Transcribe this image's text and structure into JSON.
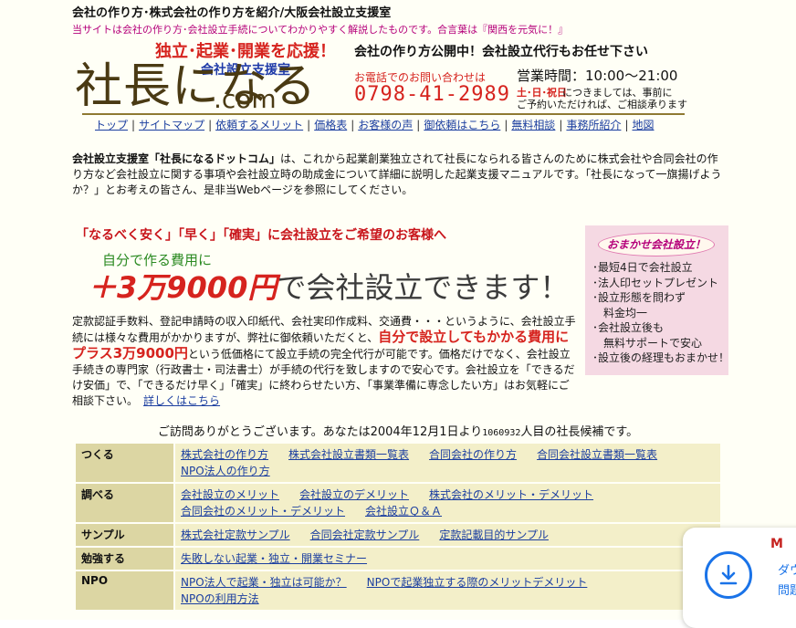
{
  "header": {
    "title": "会社の作り方･株式会社の作り方を紹介/大阪会社設立支援室",
    "subtitle": "当サイトは会社の作り方･会社設立手続についてわかりやすく解説したものです。合言葉は『関西を元気に！』",
    "logo": {
      "slogan": "独立･起業･開業を応援！",
      "sub": "会社設立支援室",
      "main": "社長になる",
      "com": ".com"
    },
    "right": {
      "headline": "会社の作り方公開中！会社設立代行もお任せ下さい",
      "tel_label": "お電話でのお問い合わせは",
      "tel": "0798-41-2989",
      "hours": "営業時間：10:00～21:00",
      "weekend": "土･日･祝日",
      "note1": "につきましては、事前に",
      "note2": "ご予約いただければ、ご相談承ります"
    }
  },
  "nav": [
    "トップ",
    "サイトマップ",
    "依頼するメリット",
    "価格表",
    "お客様の声",
    "御依頼はこちら",
    "無料相談",
    "事務所紹介",
    "地図"
  ],
  "intro": {
    "lead_bold": "会社設立支援室「社長になるドットコム」",
    "text": "は、これから起業創業独立されて社長になられる皆さんのために株式会社や合同会社の作り方など会社設立に関する事項や会社設立時の助成金について詳細に説明した起業支援マニュアルです。「社長になって一旗揚げようか？」とお考えの皆さん、是非当Webページを参照にしてください。"
  },
  "promo": {
    "headline": "「なるべく安く」「早く」「確実」に会社設立をご希望のお客様へ",
    "small": "自分で作る費用に",
    "plus": "＋3万9000円",
    "rest": "で会社設立できます！",
    "body1": "定款認証手数料、登記申請時の収入印紙代、会社実印作成料、交通費・・・というように、会社設立手続には様々な費用がかかりますが、弊社に御依頼いただくと、",
    "body_em": "自分で設立してもかかる費用にプラス3万9000円",
    "body2": "という低価格にて設立手続の完全代行が可能です。価格だけでなく、会社設立手続きの専門家（行政書士・司法書士）が手続の代行を致しますので安心です。会社設立を「できるだけ安価」で、「できるだけ早く」「確実」に終わらせたい方、「事業準備に専念したい方」はお気軽にご相談下さい。",
    "details_link": "詳しくはこちら"
  },
  "omakase": {
    "title": "おまかせ会社設立！",
    "items": [
      "･最短4日で会社設立",
      "･法人印セットプレゼント",
      "･設立形態を問わず",
      "　料金均一",
      "･会社設立後も",
      "　無料サポートで安心",
      "･設立後の経理もおまかせ！"
    ]
  },
  "visit": {
    "before": "ご訪問ありがとうございます。あなたは2004年12月1日より",
    "count": "1060932",
    "after": "人目の社長候補です。"
  },
  "menu": [
    {
      "category": "つくる",
      "links": [
        "株式会社の作り方",
        "株式会社設立書類一覧表",
        "合同会社の作り方",
        "合同会社設立書類一覧表",
        "NPO法人の作り方"
      ]
    },
    {
      "category": "調べる",
      "links": [
        "会社設立のメリット",
        "会社設立のデメリット",
        "株式会社のメリット・デメリット",
        "合同会社のメリット・デメリット",
        "会社設立Ｑ＆Ａ"
      ]
    },
    {
      "category": "サンプル",
      "links": [
        "株式会社定款サンプル",
        "合同会社定款サンプル",
        "定款記載目的サンプル"
      ]
    },
    {
      "category": "勉強する",
      "links": [
        "失敗しない起業・独立・開業セミナー"
      ]
    },
    {
      "category": "NPO",
      "links": [
        "NPO法人で起業・独立は可能か？",
        "NPOで起業独立する際のメリットデメリット",
        "NPOの利用方法"
      ]
    }
  ],
  "download_card": {
    "brand": "M",
    "text1": "ダウ",
    "text2": "問題"
  }
}
